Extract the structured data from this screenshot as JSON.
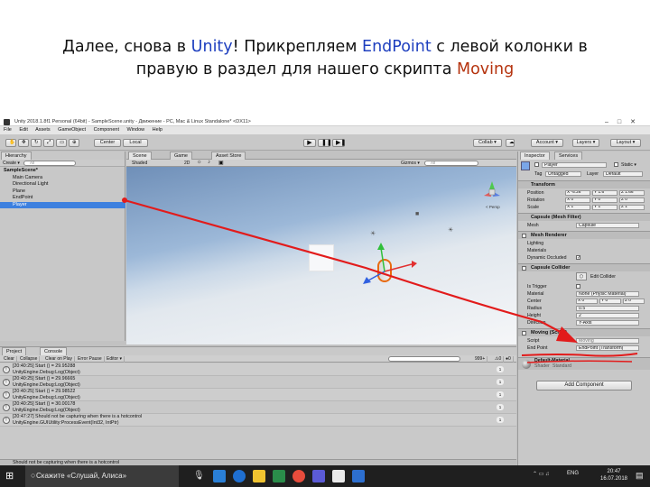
{
  "title": {
    "line1_a": "Далее, снова в ",
    "line1_unity": "Unity",
    "line1_b": "! Прикрепляем ",
    "line1_endpoint": "EndPoint",
    "line1_c": " с левой колонки в",
    "line2_a": "правую в раздел для нашего скрипта ",
    "line2_moving": "Moving"
  },
  "window": {
    "title": "Unity 2018.1.8f1 Personal (64bit) - SampleScene.unity - Движение - PC, Mac & Linux Standalone* <DX11>",
    "menu": [
      "File",
      "Edit",
      "Assets",
      "GameObject",
      "Component",
      "Window",
      "Help"
    ]
  },
  "toolbar": {
    "center": "Center",
    "local": "Local",
    "collab": "Collab ▾",
    "account": "Account ▾",
    "layers": "Layers ▾",
    "layout": "Layout ▾"
  },
  "hierarchy": {
    "tab": "Hierarchy",
    "create": "Create ▾",
    "search_placeholder": "All",
    "scene": "SampleScene*",
    "items": [
      "Main Camera",
      "Directional Light",
      "Plane",
      "EndPoint",
      "Player"
    ],
    "selected": "Player"
  },
  "scene_view": {
    "tabs": [
      "Scene",
      "Game",
      "Asset Store"
    ],
    "shading": "Shaded",
    "mode_2d": "2D",
    "gizmos": "Gizmos ▾",
    "search_placeholder": "All",
    "persp": "< Persp"
  },
  "console": {
    "tabs": [
      "Project",
      "Console"
    ],
    "buttons": [
      "Clear",
      "Collapse",
      "Clear on Play",
      "Error Pause",
      "Editor ▾"
    ],
    "counter": "999+",
    "entries": [
      {
        "line1": "[20:40:25] Start () = 29.95288",
        "line2": "UnityEngine.Debug:Log(Object)",
        "count": "1"
      },
      {
        "line1": "[20:40:25] Start () = 29.96665",
        "line2": "UnityEngine.Debug:Log(Object)",
        "count": "1"
      },
      {
        "line1": "[20:40:25] Start () = 29.98522",
        "line2": "UnityEngine.Debug:Log(Object)",
        "count": "1"
      },
      {
        "line1": "[20:40:25] Start () = 30.00178",
        "line2": "UnityEngine.Debug:Log(Object)",
        "count": "1"
      },
      {
        "line1": "[20:47:27] Should not be capturing when there is a hotcontrol",
        "line2": "UnityEngine.GUIUtility:ProcessEvent(Int32, IntPtr)",
        "count": "1"
      }
    ],
    "status": "Should not be capturing when there is a hotcontrol"
  },
  "inspector": {
    "tabs": [
      "Inspector",
      "Services"
    ],
    "object_name": "Player",
    "static_label": "Static ▾",
    "tag_label": "Tag",
    "tag_value": "Untagged",
    "layer_label": "Layer",
    "layer_value": "Default",
    "transform": {
      "header": "Transform",
      "position_label": "Position",
      "position": [
        "X -5.26",
        "Y 1.6",
        "Z 1.66"
      ],
      "rotation_label": "Rotation",
      "rotation": [
        "X 0",
        "Y 0",
        "Z 0"
      ],
      "scale_label": "Scale",
      "scale": [
        "X 1",
        "Y 1",
        "Z 1"
      ]
    },
    "mesh_filter": {
      "header": "Capsule (Mesh Filter)",
      "mesh_label": "Mesh",
      "mesh_value": "Capsule"
    },
    "mesh_renderer": {
      "header": "Mesh Renderer",
      "rows": [
        "Lighting",
        "Materials",
        "Dynamic Occluded"
      ]
    },
    "collider": {
      "header": "Capsule Collider",
      "edit_label": "Edit Collider",
      "is_trigger": "Is Trigger",
      "material_label": "Material",
      "material_value": "None (Physic Material)",
      "center_label": "Center",
      "center": [
        "X 0",
        "Y 0",
        "Z 0"
      ],
      "radius_label": "Radius",
      "radius_value": "0.5",
      "height_label": "Height",
      "height_value": "2",
      "direction_label": "Direction",
      "direction_value": "Y-Axis"
    },
    "moving": {
      "header": "Moving (Script)",
      "script_label": "Script",
      "script_value": "Moving",
      "endpoint_label": "End Point",
      "endpoint_value": "EndPoint (Transform)"
    },
    "material": {
      "name": "Default-Material",
      "shader_label": "Shader",
      "shader_value": "Standard"
    },
    "add_component": "Add Component"
  },
  "taskbar": {
    "search_text": "Скажите «Слушай, Алиса»",
    "lang": "ENG",
    "time": "20:47",
    "date": "16.07.2018"
  },
  "colors": {
    "annotation": "#e21b1b",
    "selection": "#3d80df",
    "highlight_blue": "#1e3fbf",
    "highlight_red": "#b5330e"
  }
}
